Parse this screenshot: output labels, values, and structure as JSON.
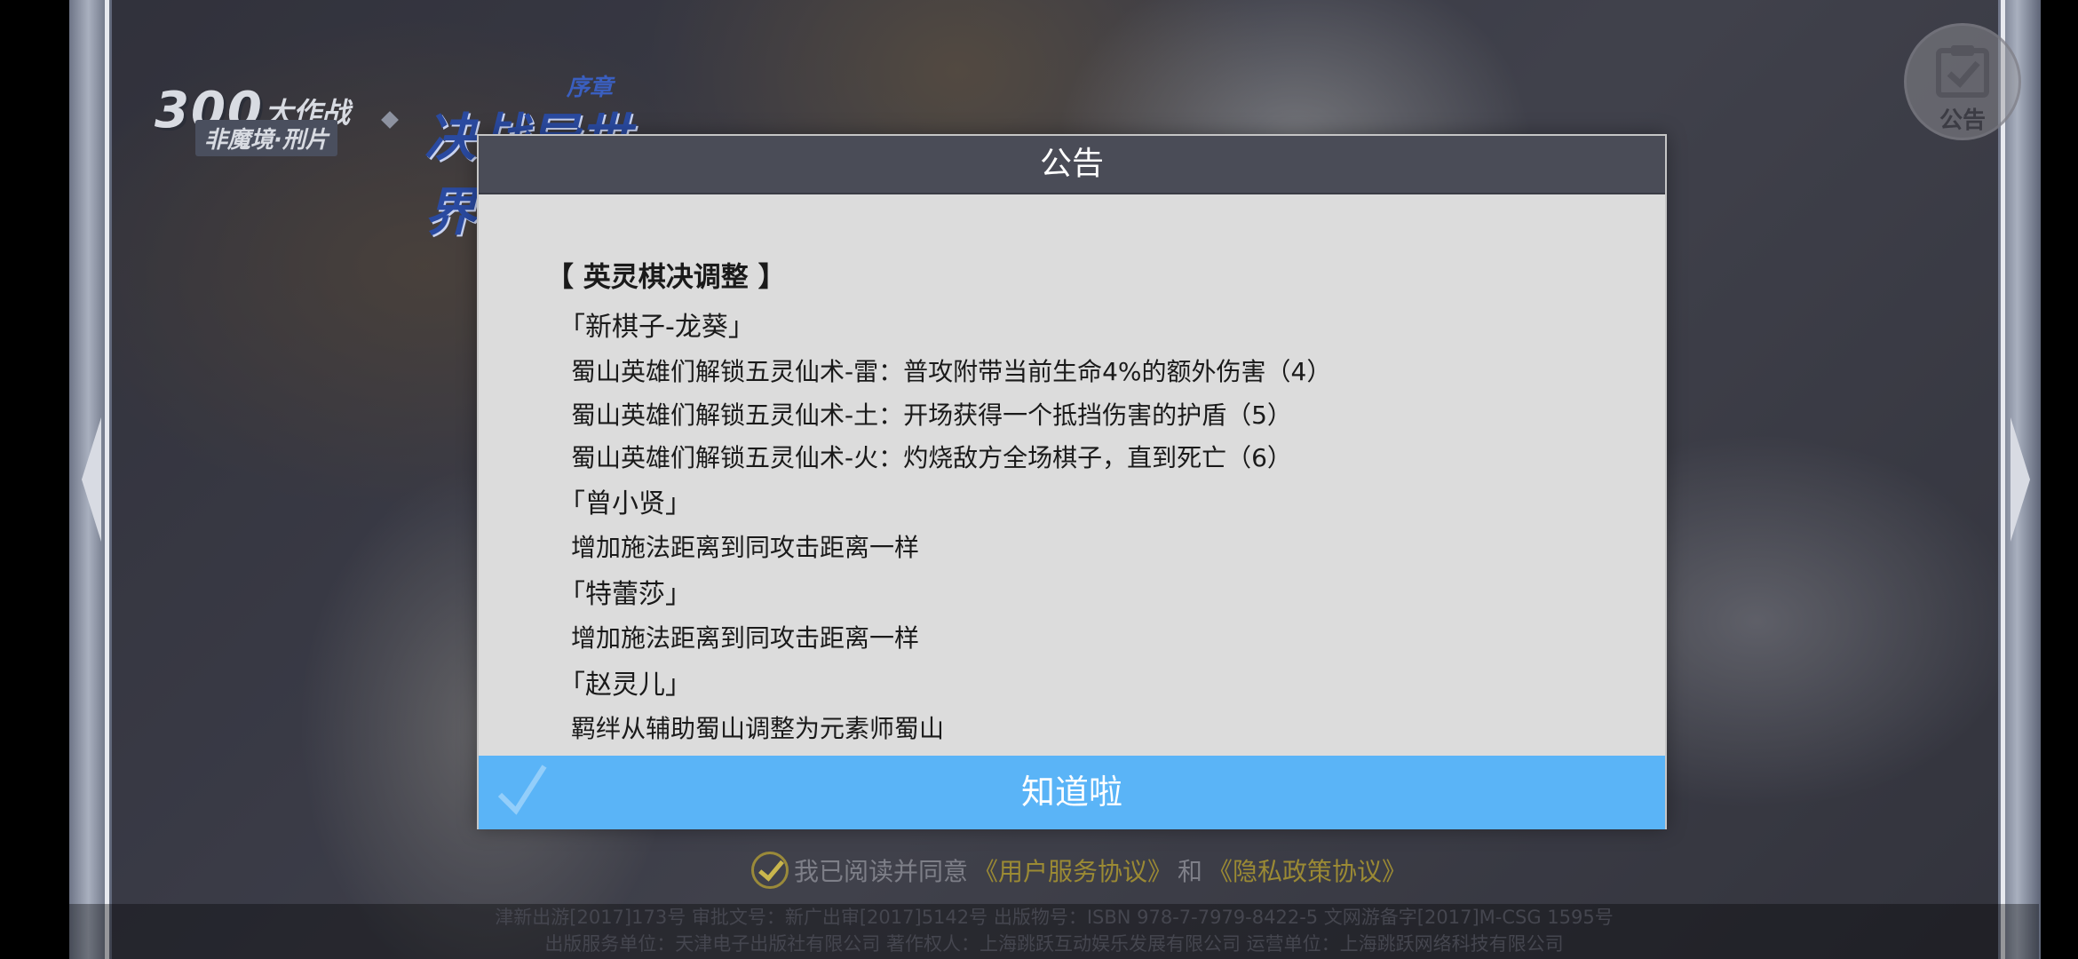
{
  "logos": {
    "game1_main": "300",
    "game1_word": "大作战",
    "game1_sub": "非魔境·刑片",
    "game2_main": "决战异世界",
    "game2_tag": "序章"
  },
  "notice_icon": {
    "icon": "clipboard-check-icon",
    "label": "公告"
  },
  "dialog": {
    "title": "公告",
    "lines": [
      "【 英灵棋决调整 】",
      "「新棋子-龙葵」",
      "蜀山英雄们解锁五灵仙术-雷：普攻附带当前生命4%的额外伤害（4）",
      "蜀山英雄们解锁五灵仙术-土：开场获得一个抵挡伤害的护盾（5）",
      "蜀山英雄们解锁五灵仙术-火：灼烧敌方全场棋子，直到死亡（6）",
      "「曾小贤」",
      "增加施法距离到同攻击距离一样",
      "「特蕾莎」",
      "增加施法距离到同攻击距离一样",
      "「赵灵儿」",
      "羁绊从辅助蜀山调整为元素师蜀山"
    ],
    "confirm_label": "知道啦"
  },
  "agreement": {
    "prefix": "我已阅读并同意",
    "link1": "《用户服务协议》",
    "conj": "和",
    "link2": "《隐私政策协议》"
  },
  "copyright": {
    "line1": "津新出游[2017]173号  审批文号：新广出审[2017]5142号  出版物号：ISBN 978-7-7979-8422-5  文网游备字[2017]M-CSG 1595号",
    "line2": "出版服务单位：天津电子出版社有限公司  著作权人：上海跳跃互动娱乐发展有限公司  运营单位：上海跳跃网络科技有限公司"
  },
  "colors": {
    "dialog_header": "#4a4c57",
    "dialog_body": "#dcdcdc",
    "confirm_button": "#5ab4f7",
    "agreement_link": "#9b8a34"
  }
}
